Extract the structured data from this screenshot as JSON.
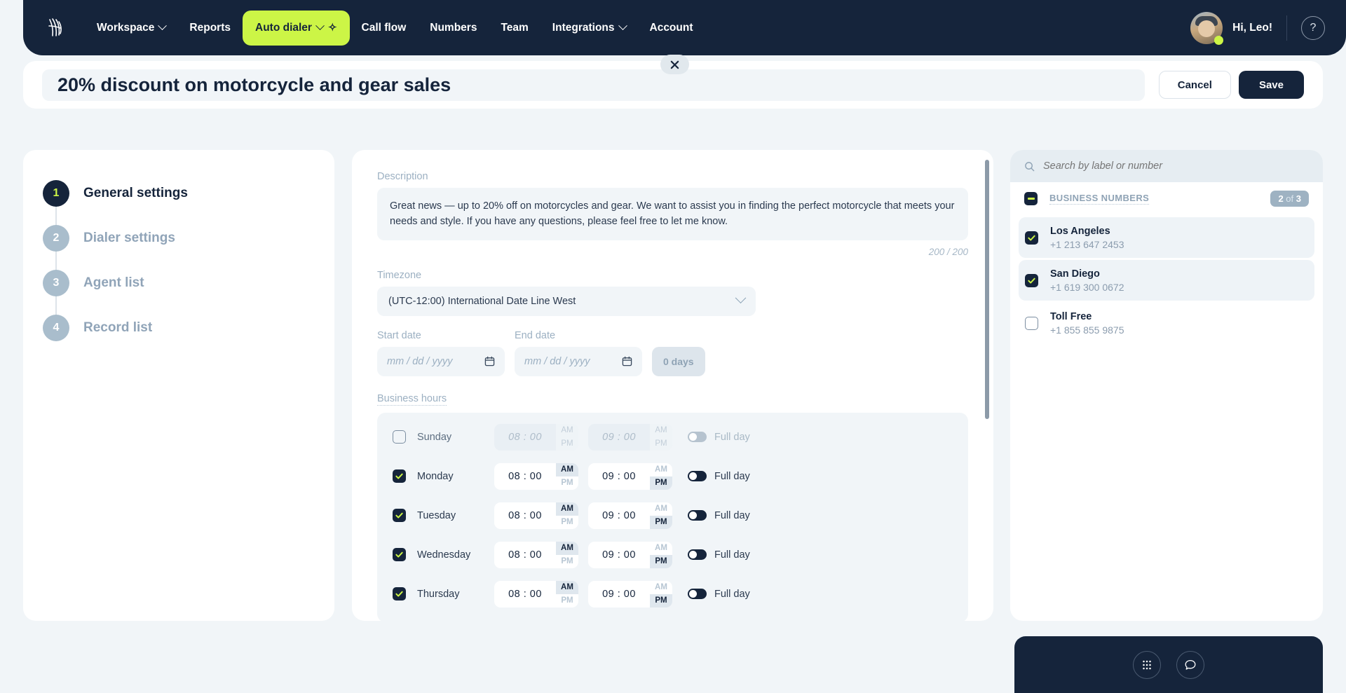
{
  "navbar": {
    "logo_icon": "hand-wave-logo",
    "items": [
      {
        "label": "Workspace",
        "has_caret": true,
        "active": false
      },
      {
        "label": "Reports",
        "has_caret": false,
        "active": false
      },
      {
        "label": "Auto dialer",
        "has_caret": true,
        "active": true,
        "sparkle": "✧"
      },
      {
        "label": "Call flow",
        "has_caret": false,
        "active": false
      },
      {
        "label": "Numbers",
        "has_caret": false,
        "active": false
      },
      {
        "label": "Team",
        "has_caret": false,
        "active": false
      },
      {
        "label": "Integrations",
        "has_caret": true,
        "active": false
      },
      {
        "label": "Account",
        "has_caret": false,
        "active": false
      }
    ],
    "greeting": "Hi, Leo!",
    "help_label": "?",
    "accent_color": "#ccf546",
    "bg_color": "#15243b"
  },
  "titlebar": {
    "campaign_title": "20% discount on motorcycle and gear sales",
    "cancel_label": "Cancel",
    "save_label": "Save"
  },
  "steps": [
    {
      "number": "1",
      "label": "General settings",
      "active": true
    },
    {
      "number": "2",
      "label": "Dialer settings",
      "active": false
    },
    {
      "number": "3",
      "label": "Agent list",
      "active": false
    },
    {
      "number": "4",
      "label": "Record list",
      "active": false
    }
  ],
  "general": {
    "description_label": "Description",
    "description_value": "Great news — up to 20% off on motorcycles and gear. We want to assist you in finding the perfect motorcycle that meets your needs and style. If you have any questions, please feel free to let me know.",
    "char_count": "200 / 200",
    "timezone_label": "Timezone",
    "timezone_value": "(UTC-12:00) International Date Line West",
    "start_date_label": "Start date",
    "start_date_placeholder": "mm / dd / yyyy",
    "end_date_label": "End date",
    "end_date_placeholder": "mm / dd / yyyy",
    "days_badge": "0 days",
    "business_hours_label": "Business hours",
    "full_day_label": "Full day",
    "rows": [
      {
        "day": "Sunday",
        "enabled": false,
        "start": "08 : 00",
        "start_ampm": "AM",
        "end": "09 : 00",
        "end_ampm": "PM",
        "full_day": false
      },
      {
        "day": "Monday",
        "enabled": true,
        "start": "08 : 00",
        "start_ampm": "AM",
        "end": "09 : 00",
        "end_ampm": "PM",
        "full_day": false
      },
      {
        "day": "Tuesday",
        "enabled": true,
        "start": "08 : 00",
        "start_ampm": "AM",
        "end": "09 : 00",
        "end_ampm": "PM",
        "full_day": false
      },
      {
        "day": "Wednesday",
        "enabled": true,
        "start": "08 : 00",
        "start_ampm": "AM",
        "end": "09 : 00",
        "end_ampm": "PM",
        "full_day": false
      },
      {
        "day": "Thursday",
        "enabled": true,
        "start": "08 : 00",
        "start_ampm": "AM",
        "end": "09 : 00",
        "end_ampm": "PM",
        "full_day": false
      }
    ]
  },
  "numbers_panel": {
    "search_placeholder": "Search by label or number",
    "group_label": "BUSINESS NUMBERS",
    "count_selected": "2",
    "count_of": " of ",
    "count_total": "3",
    "items": [
      {
        "label": "Los Angeles",
        "number": "+1 213 647 2453",
        "checked": true
      },
      {
        "label": "San Diego",
        "number": "+1 619 300 0672",
        "checked": true
      },
      {
        "label": "Toll Free",
        "number": "+1 855 855 9875",
        "checked": false
      }
    ]
  },
  "float_widget": {
    "dialpad_icon": "dialpad-icon",
    "chat_icon": "chat-bubble-icon"
  }
}
